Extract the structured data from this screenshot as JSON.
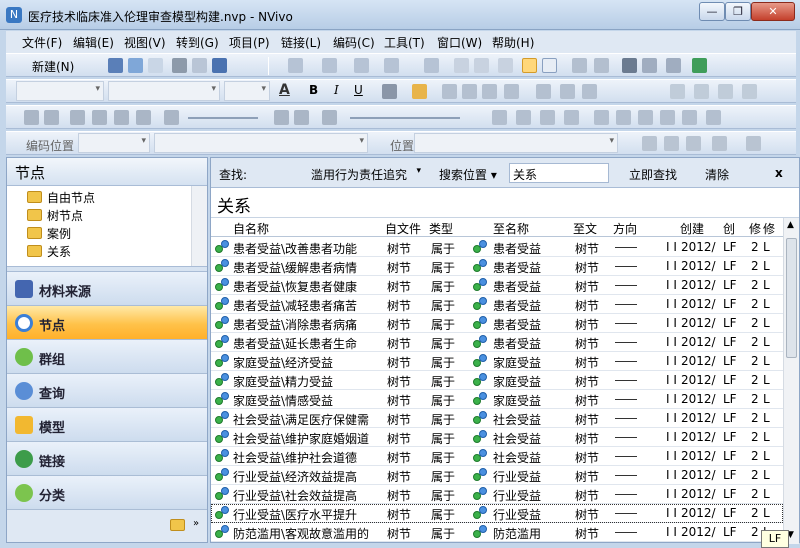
{
  "window": {
    "title": "医疗技术临床准入伦理审查模型构建.nvp - NVivo",
    "app_icon": "N",
    "minimize": "—",
    "maximize": "❐",
    "close": "✕"
  },
  "menu": [
    "文件(F)",
    "编辑(E)",
    "视图(V)",
    "转到(G)",
    "项目(P)",
    "链接(L)",
    "编码(C)",
    "工具(T)",
    "窗口(W)",
    "帮助(H)"
  ],
  "toolbar": {
    "new_label": "新建(N)",
    "coding_position_label": "编码位置",
    "position_label": "位置",
    "bold": "B",
    "italic": "I",
    "underline": "U",
    "font_color_glyph": "A"
  },
  "nav": {
    "title": "节点",
    "tree": [
      "自由节点",
      "树节点",
      "案例",
      "关系"
    ],
    "buttons": [
      {
        "label": "材料来源",
        "icon": "sources-icon",
        "active": false
      },
      {
        "label": "节点",
        "icon": "nodes-icon",
        "active": true
      },
      {
        "label": "群组",
        "icon": "sets-icon",
        "active": false
      },
      {
        "label": "查询",
        "icon": "queries-icon",
        "active": false
      },
      {
        "label": "模型",
        "icon": "models-icon",
        "active": false
      },
      {
        "label": "链接",
        "icon": "links-icon",
        "active": false
      },
      {
        "label": "分类",
        "icon": "classifications-icon",
        "active": false
      }
    ]
  },
  "find": {
    "label": "查找:",
    "find_value": "滥用行为责任追究",
    "search_in_label": "搜索位置",
    "search_in_value": "关系",
    "find_now": "立即查找",
    "clear": "清除",
    "close": "x"
  },
  "section_title": "关系",
  "columns": [
    "自名称",
    "自文件",
    "类型",
    "至名称",
    "至文",
    "方向",
    "",
    "创建",
    "创",
    "修",
    "修"
  ],
  "rows": [
    {
      "from": "患者受益\\改善患者功能",
      "from_type": "树节",
      "type": "属于",
      "to": "患者受益",
      "to_type": "树节",
      "c7": "I I",
      "created": "2012/",
      "by": "LF",
      "modified": "2",
      "mby": "L"
    },
    {
      "from": "患者受益\\缓解患者病情",
      "from_type": "树节",
      "type": "属于",
      "to": "患者受益",
      "to_type": "树节",
      "c7": "I I",
      "created": "2012/",
      "by": "LF",
      "modified": "2",
      "mby": "L"
    },
    {
      "from": "患者受益\\恢复患者健康",
      "from_type": "树节",
      "type": "属于",
      "to": "患者受益",
      "to_type": "树节",
      "c7": "I I",
      "created": "2012/",
      "by": "LF",
      "modified": "2",
      "mby": "L"
    },
    {
      "from": "患者受益\\减轻患者痛苦",
      "from_type": "树节",
      "type": "属于",
      "to": "患者受益",
      "to_type": "树节",
      "c7": "I I",
      "created": "2012/",
      "by": "LF",
      "modified": "2",
      "mby": "L"
    },
    {
      "from": "患者受益\\消除患者病痛",
      "from_type": "树节",
      "type": "属于",
      "to": "患者受益",
      "to_type": "树节",
      "c7": "I I",
      "created": "2012/",
      "by": "LF",
      "modified": "2",
      "mby": "L"
    },
    {
      "from": "患者受益\\延长患者生命",
      "from_type": "树节",
      "type": "属于",
      "to": "患者受益",
      "to_type": "树节",
      "c7": "I I",
      "created": "2012/",
      "by": "LF",
      "modified": "2",
      "mby": "L"
    },
    {
      "from": "家庭受益\\经济受益",
      "from_type": "树节",
      "type": "属于",
      "to": "家庭受益",
      "to_type": "树节",
      "c7": "I I",
      "created": "2012/",
      "by": "LF",
      "modified": "2",
      "mby": "L"
    },
    {
      "from": "家庭受益\\精力受益",
      "from_type": "树节",
      "type": "属于",
      "to": "家庭受益",
      "to_type": "树节",
      "c7": "I I",
      "created": "2012/",
      "by": "LF",
      "modified": "2",
      "mby": "L"
    },
    {
      "from": "家庭受益\\情感受益",
      "from_type": "树节",
      "type": "属于",
      "to": "家庭受益",
      "to_type": "树节",
      "c7": "I I",
      "created": "2012/",
      "by": "LF",
      "modified": "2",
      "mby": "L"
    },
    {
      "from": "社会受益\\满足医疗保健需",
      "from_type": "树节",
      "type": "属于",
      "to": "社会受益",
      "to_type": "树节",
      "c7": "I I",
      "created": "2012/",
      "by": "LF",
      "modified": "2",
      "mby": "L"
    },
    {
      "from": "社会受益\\维护家庭婚姻道",
      "from_type": "树节",
      "type": "属于",
      "to": "社会受益",
      "to_type": "树节",
      "c7": "I I",
      "created": "2012/",
      "by": "LF",
      "modified": "2",
      "mby": "L"
    },
    {
      "from": "社会受益\\维护社会道德",
      "from_type": "树节",
      "type": "属于",
      "to": "社会受益",
      "to_type": "树节",
      "c7": "I I",
      "created": "2012/",
      "by": "LF",
      "modified": "2",
      "mby": "L"
    },
    {
      "from": "行业受益\\经济效益提高",
      "from_type": "树节",
      "type": "属于",
      "to": "行业受益",
      "to_type": "树节",
      "c7": "I I",
      "created": "2012/",
      "by": "LF",
      "modified": "2",
      "mby": "L"
    },
    {
      "from": "行业受益\\社会效益提高",
      "from_type": "树节",
      "type": "属于",
      "to": "行业受益",
      "to_type": "树节",
      "c7": "I I",
      "created": "2012/",
      "by": "LF",
      "modified": "2",
      "mby": "L"
    },
    {
      "from": "行业受益\\医疗水平提升",
      "from_type": "树节",
      "type": "属于",
      "to": "行业受益",
      "to_type": "树节",
      "c7": "I I",
      "created": "2012/",
      "by": "LF",
      "modified": "2",
      "mby": "L"
    },
    {
      "from": "防范滥用\\客观故意滥用的",
      "from_type": "树节",
      "type": "属于",
      "to": "防范滥用",
      "to_type": "树节",
      "c7": "I I",
      "created": "2012/",
      "by": "LF",
      "modified": "2",
      "mby": "L"
    }
  ],
  "tooltip": "LF"
}
